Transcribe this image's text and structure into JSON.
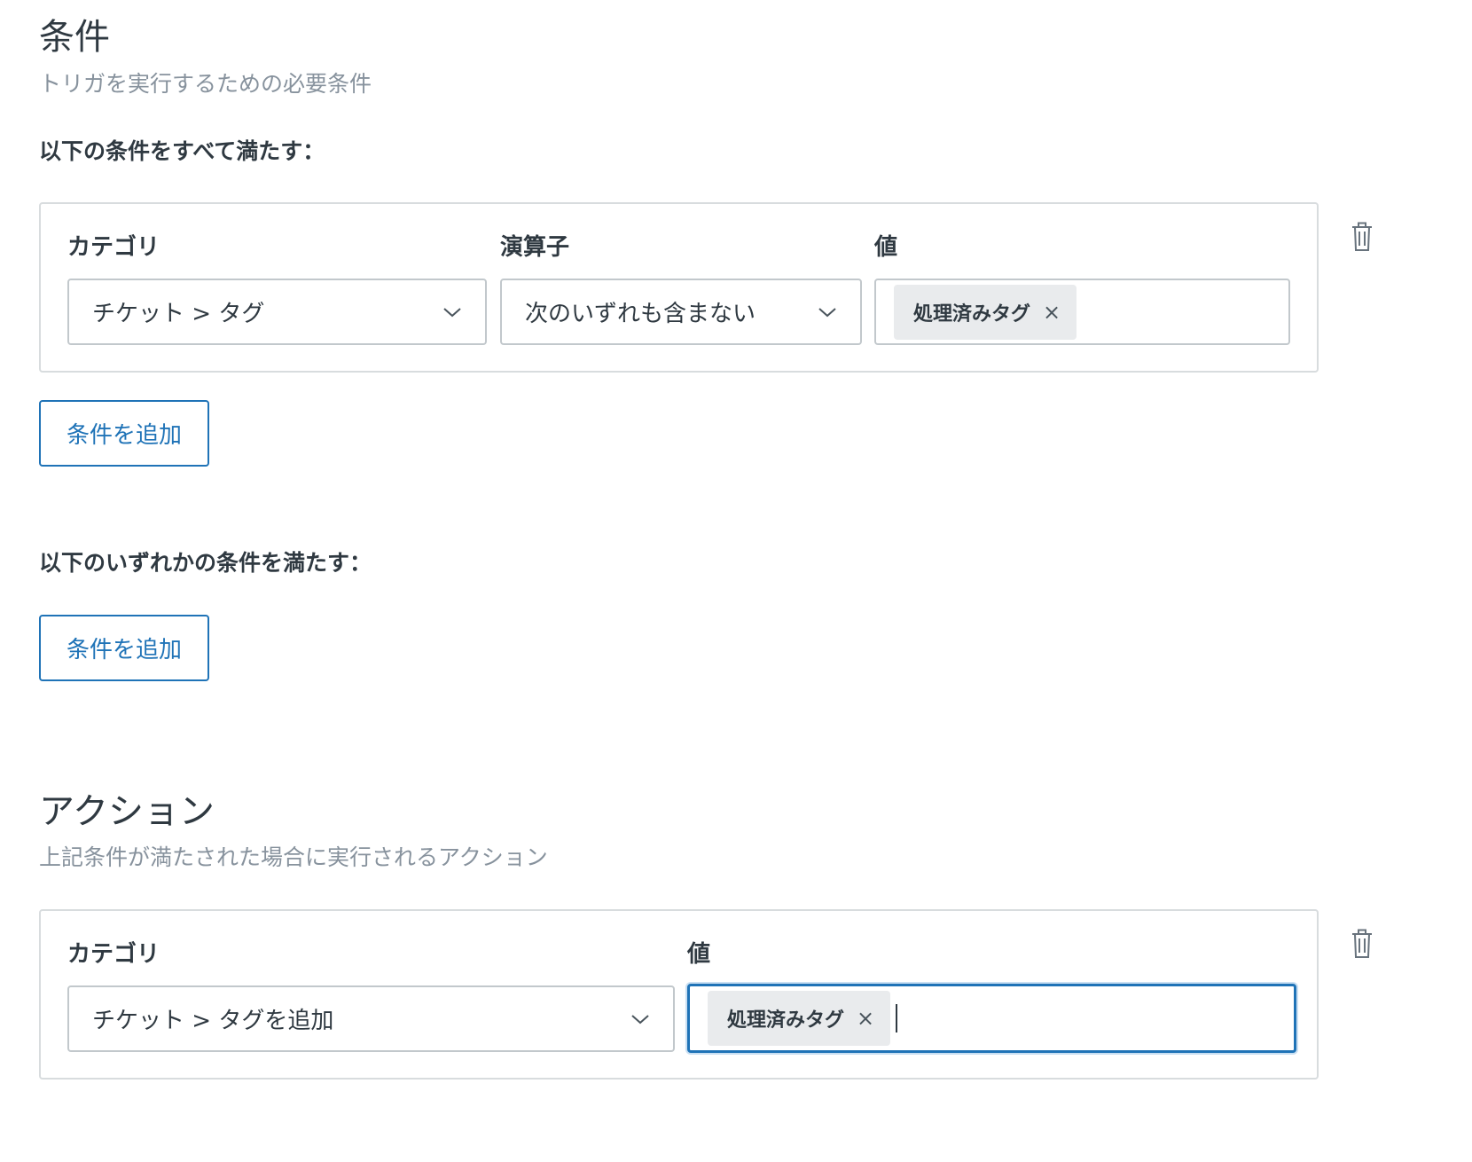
{
  "conditions": {
    "title": "条件",
    "subtitle": "トリガを実行するための必要条件",
    "all_label": "以下の条件をすべて満たす：",
    "any_label": "以下のいずれかの条件を満たす：",
    "add_button": "条件を追加",
    "rows": [
      {
        "category_label": "カテゴリ",
        "category_value": "チケット > タグ",
        "operator_label": "演算子",
        "operator_value": "次のいずれも含まない",
        "value_label": "値",
        "value_tags": [
          "処理済みタグ"
        ]
      }
    ]
  },
  "actions": {
    "title": "アクション",
    "subtitle": "上記条件が満たされた場合に実行されるアクション",
    "rows": [
      {
        "category_label": "カテゴリ",
        "category_value": "チケット > タグを追加",
        "value_label": "値",
        "value_tags": [
          "処理済みタグ"
        ]
      }
    ]
  },
  "icons": {
    "select_chevron": "chevron-down-icon",
    "delete": "trash-icon",
    "tag_remove": "close-icon"
  },
  "colors": {
    "accent": "#1f73b7",
    "text": "#2f3941",
    "muted": "#87929d",
    "border": "#d8dcde",
    "tag_bg": "#e9ebed"
  }
}
